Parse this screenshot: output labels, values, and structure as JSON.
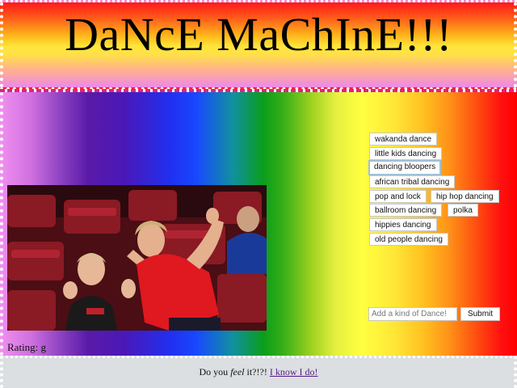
{
  "header": {
    "title": "DaNcE MaChInE!!!"
  },
  "dance_buttons": [
    {
      "label": "wakanda dance"
    },
    {
      "label": "little kids dancing"
    },
    {
      "label": "dancing bloopers"
    },
    {
      "label": "african tribal dancing"
    },
    {
      "label": "pop and lock"
    },
    {
      "label": "hip hop dancing"
    },
    {
      "label": "ballroom dancing"
    },
    {
      "label": "polka"
    },
    {
      "label": "hippies dancing"
    },
    {
      "label": "old people dancing"
    }
  ],
  "add_form": {
    "placeholder": "Add a kind of Dance!",
    "submit_label": "Submit"
  },
  "rating": {
    "text": "Rating: g"
  },
  "footer": {
    "prefix": "Do you ",
    "emphasis": "feel",
    "suffix": " it?!?! ",
    "link_text": "I know I do!"
  },
  "colors": {
    "header_top": "#ff1a1a",
    "header_mid": "#ffe63a",
    "header_bottom": "#ee88e8",
    "footer_bg": "#dcdfe2",
    "link": "#551a8b"
  }
}
